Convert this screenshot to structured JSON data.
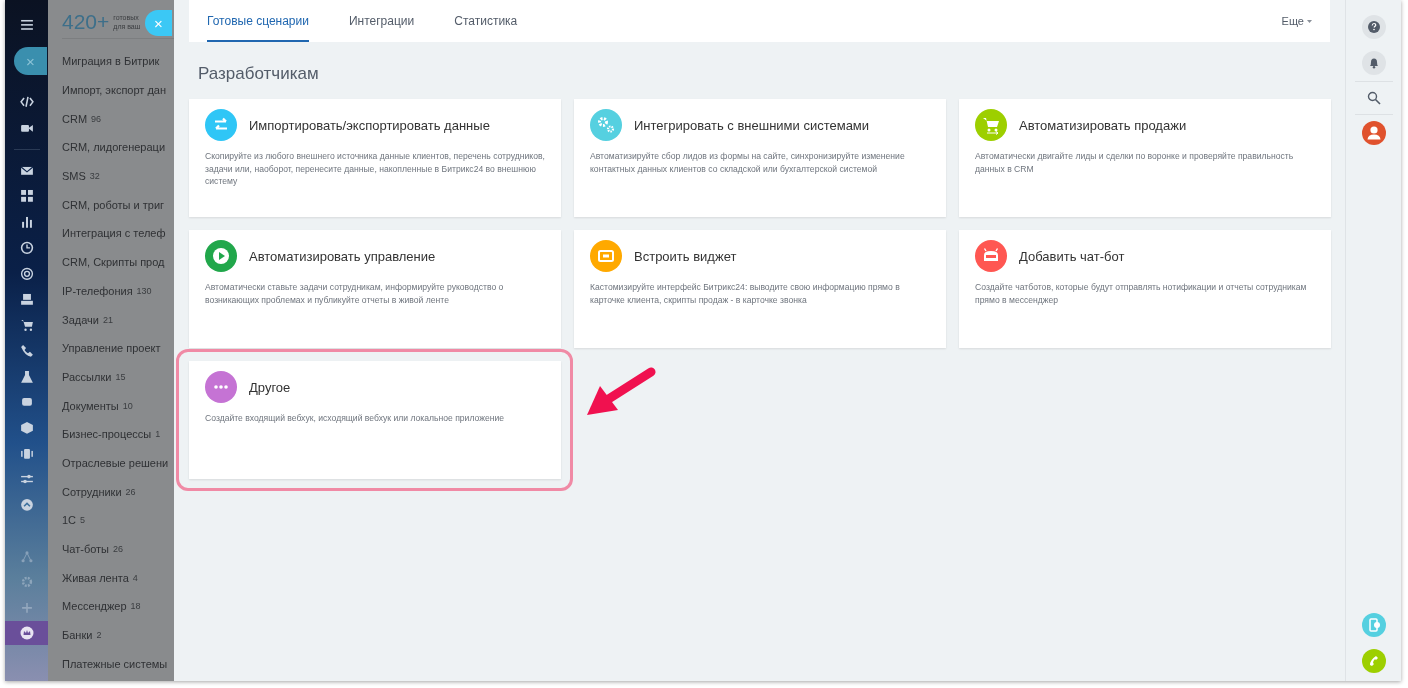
{
  "slider_close": "×",
  "panel_close": "×",
  "catalog": {
    "count": "420+",
    "caption": [
      "готовых",
      "для ваш"
    ],
    "categories": [
      {
        "name": "Миграция в Битрик"
      },
      {
        "name": "Импорт, экспорт дан"
      },
      {
        "name": "CRM",
        "count": "96"
      },
      {
        "name": "CRM, лидогенераци"
      },
      {
        "name": "SMS",
        "count": "32"
      },
      {
        "name": "CRM, роботы и триг"
      },
      {
        "name": "Интеграция с телеф"
      },
      {
        "name": "CRM, Скрипты прод"
      },
      {
        "name": "IP-телефония",
        "count": "130"
      },
      {
        "name": "Задачи",
        "count": "21"
      },
      {
        "name": "Управление проект"
      },
      {
        "name": "Рассылки",
        "count": "15"
      },
      {
        "name": "Документы",
        "count": "10"
      },
      {
        "name": "Бизнес-процессы",
        "count": "1"
      },
      {
        "name": "Отраслевые решени"
      },
      {
        "name": "Сотрудники",
        "count": "26"
      },
      {
        "name": "1С",
        "count": "5"
      },
      {
        "name": "Чат-боты",
        "count": "26"
      },
      {
        "name": "Живая лента",
        "count": "4"
      },
      {
        "name": "Мессенджер",
        "count": "18"
      },
      {
        "name": "Банки",
        "count": "2"
      },
      {
        "name": "Платежные системы"
      }
    ]
  },
  "tabs": [
    {
      "label": "Готовые сценарии",
      "selected": true
    },
    {
      "label": "Интеграции",
      "selected": false
    },
    {
      "label": "Статистика",
      "selected": false
    }
  ],
  "more": "Еще",
  "section_title": "Разработчикам",
  "cards": [
    {
      "kind": "arrows",
      "color": "#2fc6f6",
      "title": "Импортировать/экспортировать данные",
      "text": "Скопируйте из любого внешнего источника данные клиентов, перечень сотрудников, задачи или, наоборот, перенесите данные, накопленные в Битрикс24 во внешнюю систему",
      "highlighted": false
    },
    {
      "kind": "gears",
      "color": "#55d0e0",
      "title": "Интегрировать с внешними системами",
      "text": "Автоматизируйте сбор лидов из формы на сайте, синхронизируйте изменение контактных данных клиентов со складской или бухгалтерской системой",
      "highlighted": false
    },
    {
      "kind": "cart",
      "color": "#9dcf00",
      "title": "Автоматизировать продажи",
      "text": "Автоматически двигайте лиды и сделки по воронке и проверяйте правильность данных в CRM",
      "highlighted": false
    },
    {
      "kind": "play",
      "color": "#21a74b",
      "title": "Автоматизировать управление",
      "text": "Автоматически ставьте задачи сотрудникам, информируйте руководство о возникающих проблемах и публикуйте отчеты в живой ленте",
      "highlighted": false
    },
    {
      "kind": "widget",
      "color": "#ffa900",
      "title": "Встроить виджет",
      "text": "Кастомизируйте интерфейс Битрикс24: выводите свою информацию прямо в карточке клиента, скрипты продаж - в карточке звонка",
      "highlighted": false
    },
    {
      "kind": "robot",
      "color": "#ff5752",
      "title": "Добавить чат-бот",
      "text": "Создайте чатботов, которые будут отправлять нотификации и отчеты сотрудникам прямо в мессенджер",
      "highlighted": false
    },
    {
      "kind": "dots",
      "color": "#c573d4",
      "title": "Другое",
      "text": "Создайте входящий вебхук, исходящий вебхук или локальное приложение",
      "highlighted": true
    }
  ]
}
